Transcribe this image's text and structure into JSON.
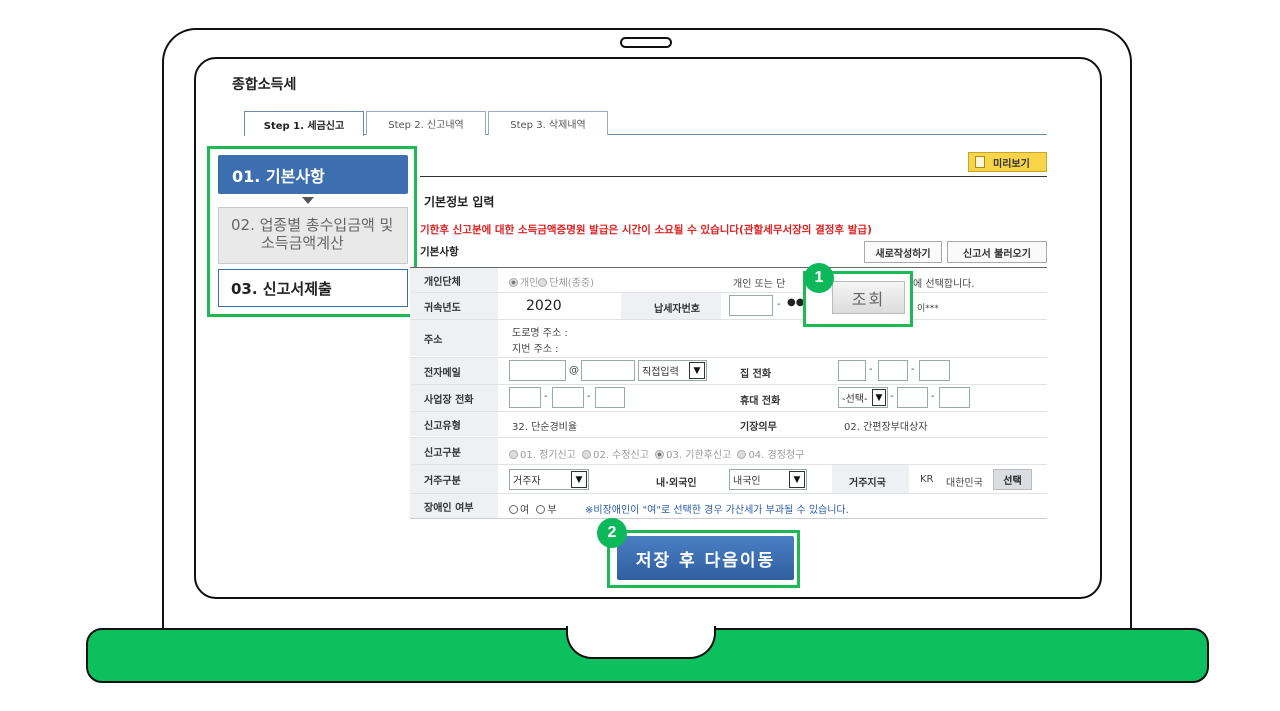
{
  "page_title": "종합소득세",
  "tabs": [
    {
      "label": "Step 1. 세금신고"
    },
    {
      "label": "Step 2. 신고내역"
    },
    {
      "label": "Step 3. 삭제내역"
    }
  ],
  "sidebar": {
    "step1": "01. 기본사항",
    "step2_line1": "02. 업종별 총수입금액 및",
    "step2_line2": "소득금액계산",
    "step3": "03. 신고서제출"
  },
  "preview_label": "미리보기",
  "section_title": "기본정보 입력",
  "warning": "기한후 신고분에 대한 소득금액증명원 발급은 시간이 소요될 수 있습니다(관할세무서장의 결정후 발급)",
  "subsection": "기본사항",
  "buttons": {
    "new": "새로작성하기",
    "load": "신고서 불러오기",
    "lookup": "조회",
    "choose": "선택",
    "save_next": "저장 후 다음이동"
  },
  "badges": {
    "one": "1",
    "two": "2"
  },
  "form": {
    "entity_label": "개인단체",
    "entity_individual": "개인",
    "entity_group": "단체(종중)",
    "entity_note_a": "개인 또는 단",
    "entity_note_b": "에 선택합니다.",
    "year_label": "귀속년도",
    "year_value": "2020",
    "taxpayer_no_label": "납세자번호",
    "taxpayer_dash": "-",
    "taxpayer_mask": "●●",
    "name_mask": "이***",
    "address_label": "주소",
    "road_address": "도로명 주소 :",
    "lot_address": "지번 주소 :",
    "email_label": "전자메일",
    "email_at": "@",
    "email_domain_select": "직접입력",
    "home_phone_label": "집 전화",
    "work_phone_label": "사업장 전화",
    "mobile_label": "휴대 전화",
    "mobile_select": "-선택-",
    "report_type_label": "신고유형",
    "report_type_value": "32. 단순경비율",
    "bookkeeping_label": "기장의무",
    "bookkeeping_value": "02. 간편장부대상자",
    "report_class_label": "신고구분",
    "report_class_options": [
      "01. 정기신고",
      "02. 수정신고",
      "03. 기한후신고",
      "04. 경정청구"
    ],
    "residency_label": "거주구분",
    "residency_value": "거주자",
    "nationality_label": "내·외국인",
    "nationality_value": "내국인",
    "country_label": "거주지국",
    "country_code": "KR",
    "country_name": "대한민국",
    "disabled_label": "장애인 여부",
    "disabled_yes": "여",
    "disabled_no": "부",
    "disabled_note": "※비장애인이 \"여\"로 선택한 경우 가산세가 부과될 수 있습니다."
  }
}
